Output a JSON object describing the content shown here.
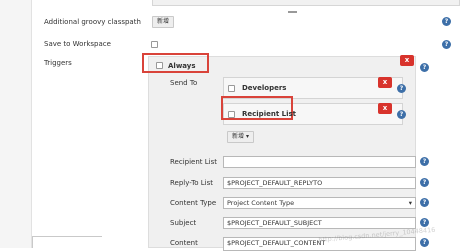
{
  "rows": {
    "classpath_label": "Additional groovy classpath",
    "add_button": "新增",
    "save_workspace_label": "Save to Workspace",
    "triggers_label": "Triggers"
  },
  "trigger": {
    "name": "Always",
    "send_to_label": "Send To",
    "recipients": [
      {
        "name": "Developers",
        "remove": "x"
      },
      {
        "name": "Recipient List",
        "remove": "x"
      }
    ],
    "remove": "x",
    "add_dropdown": "新增"
  },
  "fields": {
    "recipient_list_label": "Recipient List",
    "recipient_list_value": "",
    "reply_to_label": "Reply-To List",
    "reply_to_value": "$PROJECT_DEFAULT_REPLYTO",
    "content_type_label": "Content Type",
    "content_type_value": "Project Content Type",
    "subject_label": "Subject",
    "subject_value": "$PROJECT_DEFAULT_SUBJECT",
    "content_label": "Content",
    "content_value": "$PROJECT_DEFAULT_CONTENT"
  },
  "help": "?",
  "watermark": "http://blog.csdn.net/jerry_10448416",
  "colors": {
    "help": "#3d6fa8",
    "remove": "#d8332c",
    "highlight": "#d9433a",
    "panel": "#f0f0f0"
  }
}
